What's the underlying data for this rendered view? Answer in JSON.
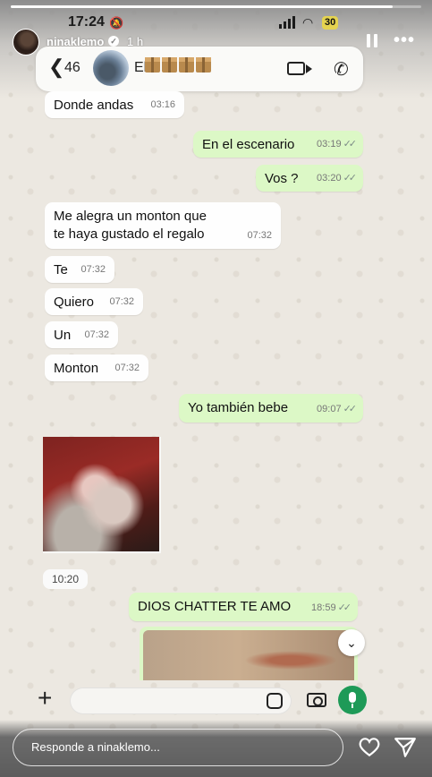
{
  "status_bar": {
    "time": "17:24",
    "battery": "30"
  },
  "story": {
    "progress": 0.93,
    "username": "ninaklemo",
    "posted_ago": "1 h"
  },
  "chat_header": {
    "back_count": "46",
    "contact_name": "El",
    "name_emoji": "package-box x4"
  },
  "messages": [
    {
      "dir": "in",
      "text": "Donde andas",
      "time": "03:16"
    },
    {
      "dir": "out",
      "text": "En el escenario",
      "time": "03:19"
    },
    {
      "dir": "out",
      "text": "Vos ?",
      "time": "03:20"
    },
    {
      "dir": "in",
      "text": "Me alegra un monton que te haya gustado el regalo",
      "time": "07:32"
    },
    {
      "dir": "in",
      "text": "Te",
      "time": "07:32"
    },
    {
      "dir": "in",
      "text": "Quiero",
      "time": "07:32"
    },
    {
      "dir": "in",
      "text": "Un",
      "time": "07:32"
    },
    {
      "dir": "in",
      "text": "Monton",
      "time": "07:32"
    },
    {
      "dir": "out",
      "text": "Yo también bebe",
      "time": "09:07"
    },
    {
      "dir": "in",
      "type": "image",
      "time": "10:20"
    },
    {
      "dir": "out",
      "text": "DIOS CHATTER TE AMO",
      "time": "18:59"
    }
  ],
  "composer": {
    "placeholder": ""
  },
  "reply": {
    "placeholder": "Responde a ninaklemo..."
  }
}
